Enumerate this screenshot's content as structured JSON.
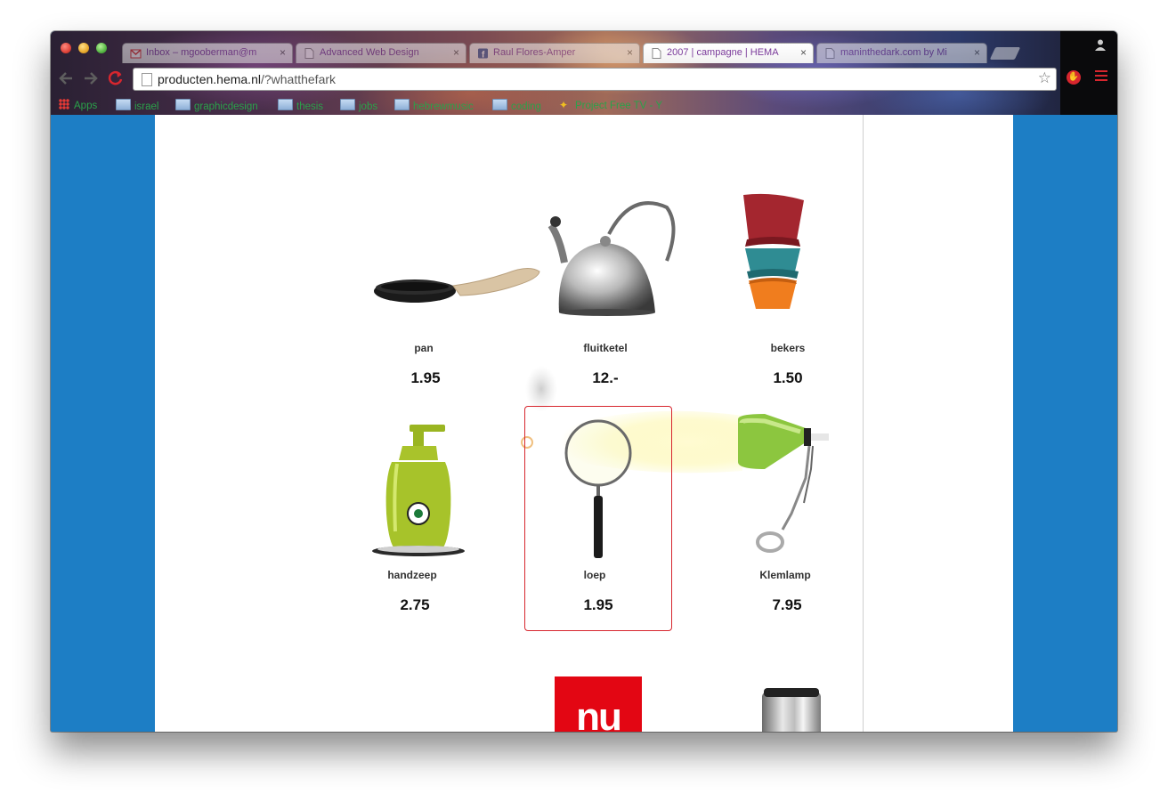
{
  "browser": {
    "tabs": [
      {
        "label": "Inbox – mgooberman@m",
        "icon": "gmail-icon",
        "active": false
      },
      {
        "label": "Advanced Web Design",
        "icon": "page-icon",
        "active": false
      },
      {
        "label": "Raul Flores-Amper",
        "icon": "facebook-icon",
        "active": false
      },
      {
        "label": "2007 | campagne | HEMA",
        "icon": "page-icon",
        "active": true
      },
      {
        "label": "maninthedark.com by Mi",
        "icon": "page-icon",
        "active": false
      }
    ],
    "close_glyph": "×",
    "url_host": "producten.hema.nl",
    "url_path": "/?whatthefark",
    "bookmarks": [
      {
        "label": "Apps",
        "icon": "apps-grid-icon"
      },
      {
        "label": "israel",
        "icon": "folder-icon"
      },
      {
        "label": "graphicdesign",
        "icon": "folder-icon"
      },
      {
        "label": "thesis",
        "icon": "folder-icon"
      },
      {
        "label": "jobs",
        "icon": "folder-icon"
      },
      {
        "label": "hebrewmusic",
        "icon": "folder-icon"
      },
      {
        "label": "coding",
        "icon": "folder-icon"
      },
      {
        "label": "Project Free TV - Y",
        "icon": "projectfreetv-icon"
      }
    ]
  },
  "products": [
    {
      "name": "pan",
      "price": "1.95"
    },
    {
      "name": "fluitketel",
      "price": "12.-"
    },
    {
      "name": "bekers",
      "price": "1.50"
    },
    {
      "name": "handzeep",
      "price": "2.75"
    },
    {
      "name": "loep",
      "price": "1.95"
    },
    {
      "name": "Klemlamp",
      "price": "7.95"
    }
  ],
  "logo": {
    "text": "nu",
    "color": "#e30613"
  },
  "colors": {
    "page_background": "#1d7ec5",
    "selection_border": "#d7262e",
    "bookmark_text": "#2aa24a",
    "tab_text": "#7a3a9a"
  }
}
